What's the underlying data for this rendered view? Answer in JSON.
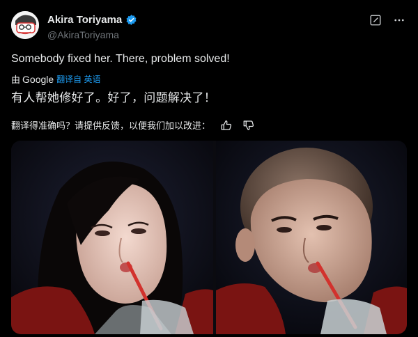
{
  "author": {
    "display_name": "Akira Toriyama",
    "handle": "@AkiraToriyama",
    "verified": true
  },
  "tweet": {
    "text": "Somebody fixed her. There, problem solved!"
  },
  "translation": {
    "by_label": "由",
    "provider": "Google",
    "action_label": "翻译自 英语",
    "text": "有人帮她修好了。好了，问题解决了！",
    "feedback_prompt": "翻译得准确吗？请提供反馈，以便我们加以改进："
  },
  "icons": {
    "verified": "verified-badge-icon",
    "edit": "edit-icon",
    "more": "more-icon",
    "thumbs_up": "thumbs-up-icon",
    "thumbs_down": "thumbs-down-icon"
  },
  "media": {
    "images": [
      {
        "name": "photo-left",
        "description": "woman with long dark hair drinking through a red straw"
      },
      {
        "name": "photo-right",
        "description": "same woman edited bald drinking through a red straw"
      }
    ]
  },
  "colors": {
    "background": "#000000",
    "text": "#e7e9ea",
    "muted": "#71767b",
    "accent": "#1d9bf0"
  }
}
